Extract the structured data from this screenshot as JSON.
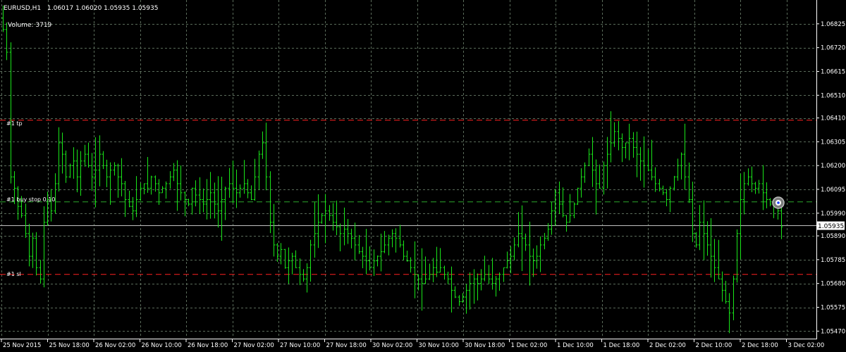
{
  "header": {
    "symbol_tf": "EURUSD,H1",
    "ohlc": "1.06017 1.06020 1.05935 1.05935",
    "volume_label": "Volume: 3719"
  },
  "orders": {
    "tp_label": "#1 tp",
    "buy_stop_label": "#1 buy stop 0.10",
    "sl_label": "#1 sl"
  },
  "current_price_label": "1.05935",
  "colors": {
    "background": "#000000",
    "grid": "#5a6b5a",
    "bars": "#19e619",
    "axis_text": "#ffffff",
    "tp_sl_line": "#ff2020",
    "buy_stop_line": "#2da82d",
    "price_line": "#c0c0c0",
    "price_tag_bg": "#ffffff",
    "price_tag_text": "#000000"
  },
  "chart_data": {
    "type": "bar",
    "symbol": "EURUSD",
    "timeframe": "H1",
    "ylim": [
      1.0544,
      1.0693
    ],
    "y_ticks": [
      1.06825,
      1.0672,
      1.06615,
      1.0651,
      1.0641,
      1.06305,
      1.062,
      1.06095,
      1.0599,
      1.0589,
      1.05785,
      1.0568,
      1.05575,
      1.0547
    ],
    "x_tick_labels": [
      "25 Nov 2015",
      "25 Nov 18:00",
      "26 Nov 02:00",
      "26 Nov 10:00",
      "26 Nov 18:00",
      "27 Nov 02:00",
      "27 Nov 10:00",
      "27 Nov 18:00",
      "30 Nov 02:00",
      "30 Nov 10:00",
      "30 Nov 18:00",
      "1 Dec 02:00",
      "1 Dec 10:00",
      "1 Dec 18:00",
      "2 Dec 02:00",
      "2 Dec 10:00",
      "2 Dec 18:00",
      "3 Dec 02:00"
    ],
    "levels": {
      "tp": 1.064,
      "buy_stop": 1.0604,
      "sl": 1.0572,
      "current": 1.05935
    },
    "close_anchors": [
      1.068,
      1.067,
      1.0615,
      1.061,
      1.0602,
      1.0598,
      1.059,
      1.058,
      1.0588,
      1.0575,
      1.057,
      1.0595,
      1.0605,
      1.06,
      1.0612,
      1.063,
      1.0625,
      1.0615,
      1.062,
      1.0622,
      1.0615,
      1.0622,
      1.0625,
      1.062,
      1.0615,
      1.0618,
      1.0625,
      1.062,
      1.0615,
      1.0618,
      1.062,
      1.0615,
      1.0612,
      1.0605,
      1.0602,
      1.06,
      1.0605,
      1.061,
      1.0612,
      1.061,
      1.0615,
      1.0612,
      1.0608,
      1.061,
      1.0612,
      1.0615,
      1.0618,
      1.0612,
      1.0608,
      1.0605,
      1.0603,
      1.061,
      1.0607,
      1.0605,
      1.0603,
      1.0605,
      1.0608,
      1.0603,
      1.06,
      1.0605,
      1.061,
      1.0612,
      1.061,
      1.0608,
      1.061,
      1.0612,
      1.0608,
      1.0605,
      1.0615,
      1.0625,
      1.063,
      1.0615,
      1.0595,
      1.0585,
      1.058,
      1.0583,
      1.0575,
      1.0578,
      1.058,
      1.0575,
      1.0572,
      1.057,
      1.0575,
      1.0585,
      1.059,
      1.0595,
      1.0598,
      1.06,
      1.0598,
      1.0595,
      1.0593,
      1.059,
      1.0592,
      1.059,
      1.0588,
      1.0585,
      1.0582,
      1.058,
      1.0578,
      1.0575,
      1.0578,
      1.058,
      1.0582,
      1.0585,
      1.0588,
      1.059,
      1.0588,
      1.0585,
      1.058,
      1.0578,
      1.0575,
      1.0572,
      1.057,
      1.0568,
      1.057,
      1.0572,
      1.0575,
      1.0573,
      1.0575,
      1.0572,
      1.057,
      1.0565,
      1.0562,
      1.056,
      1.0562,
      1.0565,
      1.0568,
      1.057,
      1.0568,
      1.057,
      1.0572,
      1.057,
      1.0568,
      1.057,
      1.0572,
      1.0575,
      1.0578,
      1.058,
      1.0585,
      1.059,
      1.0588,
      1.0585,
      1.058,
      1.0578,
      1.058,
      1.0585,
      1.0588,
      1.0592,
      1.06,
      1.0608,
      1.0603,
      1.0598,
      1.0595,
      1.0598,
      1.0603,
      1.061,
      1.0615,
      1.062,
      1.0625,
      1.0618,
      1.0612,
      1.061,
      1.062,
      1.0625,
      1.063,
      1.0635,
      1.0632,
      1.0628,
      1.063,
      1.0632,
      1.0628,
      1.0625,
      1.0622,
      1.062,
      1.0618,
      1.0615,
      1.0612,
      1.061,
      1.0608,
      1.0605,
      1.061,
      1.0615,
      1.062,
      1.0625,
      1.0615,
      1.0605,
      1.059,
      1.0585,
      1.0595,
      1.059,
      1.0585,
      1.058,
      1.0575,
      1.057,
      1.0565,
      1.056,
      1.0555,
      1.057,
      1.059,
      1.0605,
      1.0612,
      1.0615,
      1.0612,
      1.061,
      1.0612,
      1.0608,
      1.0605,
      1.0603,
      1.0602,
      1.06,
      1.0593
    ],
    "bar_range": 0.001
  }
}
